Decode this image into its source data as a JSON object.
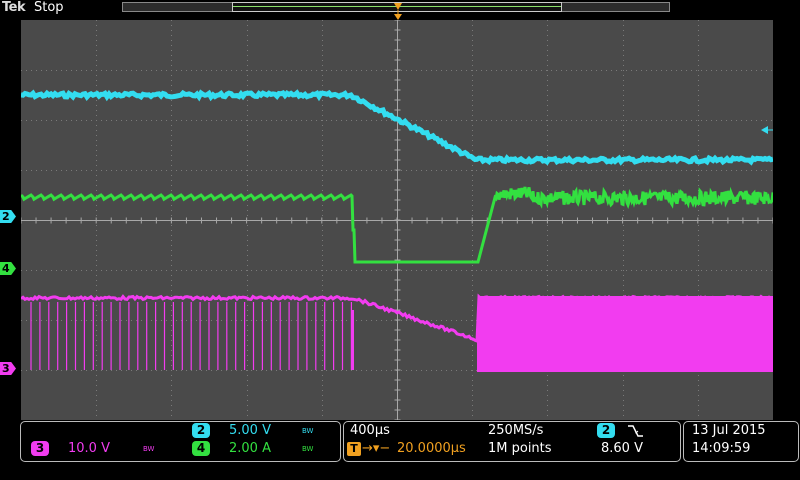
{
  "top": {
    "brand": "Tek",
    "state": "Stop",
    "trigger_marker": "T"
  },
  "channels": [
    {
      "id": "2",
      "color": "#33ddf0",
      "scale": "5.00 V",
      "bw": "BW"
    },
    {
      "id": "4",
      "color": "#33e040",
      "scale": "2.00 A",
      "bw": "BW"
    },
    {
      "id": "3",
      "color": "#f23cf0",
      "scale": "10.0 V",
      "bw": "BW"
    }
  ],
  "timebase": {
    "time_div": "400µs",
    "sample_rate": "250MS/s",
    "delay": "20.0000µs",
    "record_length": "1M points"
  },
  "trigger": {
    "source": "2",
    "slope_icon": "falling-edge-icon",
    "level": "8.60 V"
  },
  "datetime": {
    "date": "13 Jul  2015",
    "time": "14:09:59"
  }
}
